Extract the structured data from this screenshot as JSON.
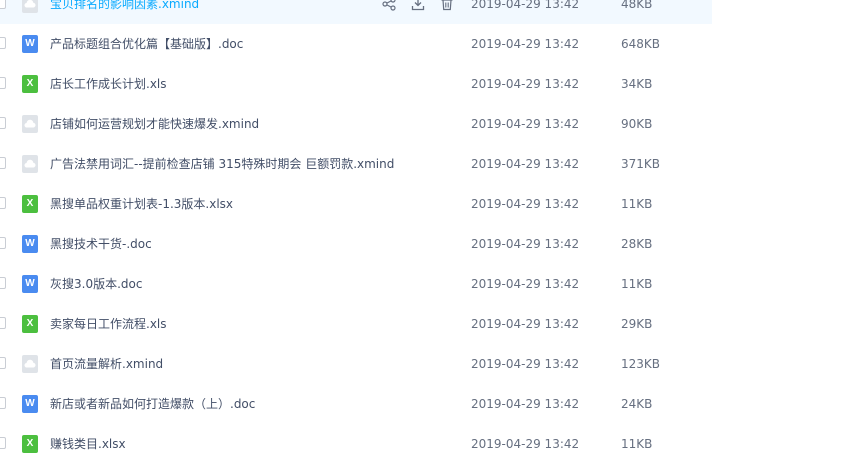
{
  "files": [
    {
      "name": "宝贝排名的影响因素.xmind",
      "type": "xmind",
      "icon": "xmind-cloud-icon",
      "date": "2019-04-29 13:42",
      "size": "48KB",
      "hover": true,
      "actions": [
        {
          "name": "share",
          "icon": "share-icon"
        },
        {
          "name": "download",
          "icon": "download-icon"
        },
        {
          "name": "delete",
          "icon": "trash-icon"
        }
      ]
    },
    {
      "name": "产品标题组合优化篇【基础版】.doc",
      "type": "word",
      "icon": "word-doc-icon",
      "glyph": "W",
      "date": "2019-04-29 13:42",
      "size": "648KB"
    },
    {
      "name": "店长工作成长计划.xls",
      "type": "excel",
      "icon": "excel-xls-icon",
      "glyph": "X",
      "date": "2019-04-29 13:42",
      "size": "34KB"
    },
    {
      "name": "店铺如何运营规划才能快速爆发.xmind",
      "type": "xmind",
      "icon": "xmind-cloud-icon",
      "date": "2019-04-29 13:42",
      "size": "90KB"
    },
    {
      "name": "广告法禁用词汇--提前检查店铺  315特殊时期会 巨额罚款.xmind",
      "type": "xmind",
      "icon": "xmind-cloud-icon",
      "date": "2019-04-29 13:42",
      "size": "371KB"
    },
    {
      "name": "黑搜单品权重计划表-1.3版本.xlsx",
      "type": "excel",
      "icon": "excel-xls-icon",
      "glyph": "X",
      "date": "2019-04-29 13:42",
      "size": "11KB"
    },
    {
      "name": "黑搜技术干货-.doc",
      "type": "word",
      "icon": "word-doc-icon",
      "glyph": "W",
      "date": "2019-04-29 13:42",
      "size": "28KB"
    },
    {
      "name": "灰搜3.0版本.doc",
      "type": "word",
      "icon": "word-doc-icon",
      "glyph": "W",
      "date": "2019-04-29 13:42",
      "size": "11KB"
    },
    {
      "name": "卖家每日工作流程.xls",
      "type": "excel",
      "icon": "excel-xls-icon",
      "glyph": "X",
      "date": "2019-04-29 13:42",
      "size": "29KB"
    },
    {
      "name": "首页流量解析.xmind",
      "type": "xmind",
      "icon": "xmind-cloud-icon",
      "date": "2019-04-29 13:42",
      "size": "123KB"
    },
    {
      "name": "新店或者新品如何打造爆款（上）.doc",
      "type": "word",
      "icon": "word-doc-icon",
      "glyph": "W",
      "date": "2019-04-29 13:42",
      "size": "24KB"
    },
    {
      "name": "赚钱类目.xlsx",
      "type": "excel",
      "icon": "excel-xls-icon",
      "glyph": "X",
      "date": "2019-04-29 13:42",
      "size": "11KB"
    }
  ],
  "colors": {
    "hover_row_bg": "#f2f9ff",
    "hover_text": "#09aaff",
    "word": "#4a8bf0",
    "excel": "#4cbf3f",
    "xmind": "#dfe3e8"
  }
}
